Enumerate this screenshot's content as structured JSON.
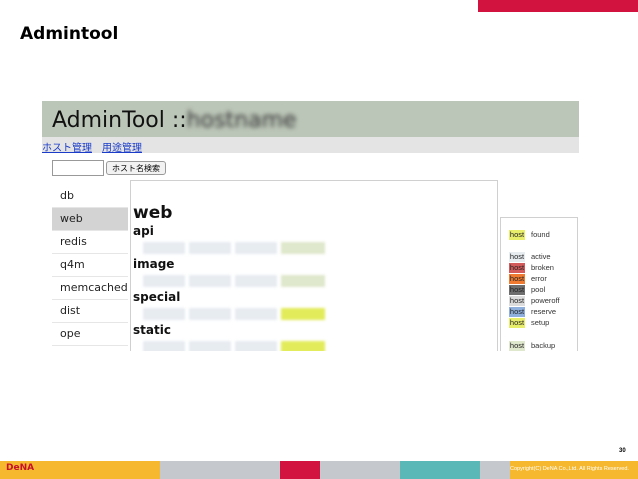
{
  "slide": {
    "title": "Admintool",
    "page_number": "30",
    "logo": "DeNA",
    "copyright": "Copyright(C) DeNA Co.,Ltd. All Rights Reserved."
  },
  "app": {
    "title_prefix": "AdminTool ::",
    "title_blurred": "hostname",
    "nav": [
      "ホスト管理",
      "用途管理"
    ],
    "search_button": "ホスト名検索",
    "search_value": ""
  },
  "sidebar": {
    "items": [
      "db",
      "web",
      "redis",
      "q4m",
      "memcached",
      "dist",
      "ope"
    ],
    "active": "web"
  },
  "main": {
    "section": "web",
    "groups": [
      "api",
      "image",
      "special",
      "static"
    ]
  },
  "legend": {
    "badge_text": "host",
    "items": [
      {
        "label": "found",
        "color": "#e8ed6a"
      },
      {
        "label": "active",
        "color": "#e7ecf1"
      },
      {
        "label": "broken",
        "color": "#d35a5a"
      },
      {
        "label": "error",
        "color": "#f07a30"
      },
      {
        "label": "pool",
        "color": "#6e6e6e"
      },
      {
        "label": "poweroff",
        "color": "#dcdcdc"
      },
      {
        "label": "reserve",
        "color": "#8fb0dd"
      },
      {
        "label": "setup",
        "color": "#e8ed6a"
      },
      {
        "label": "backup",
        "color": "#dfe7cc"
      }
    ]
  },
  "footer": {
    "colors": [
      "#f5b82e",
      "#c5c9ce",
      "#d2133f",
      "#c5c9ce",
      "#5ab9b7",
      "#c5c9ce",
      "#f5b82e"
    ]
  }
}
